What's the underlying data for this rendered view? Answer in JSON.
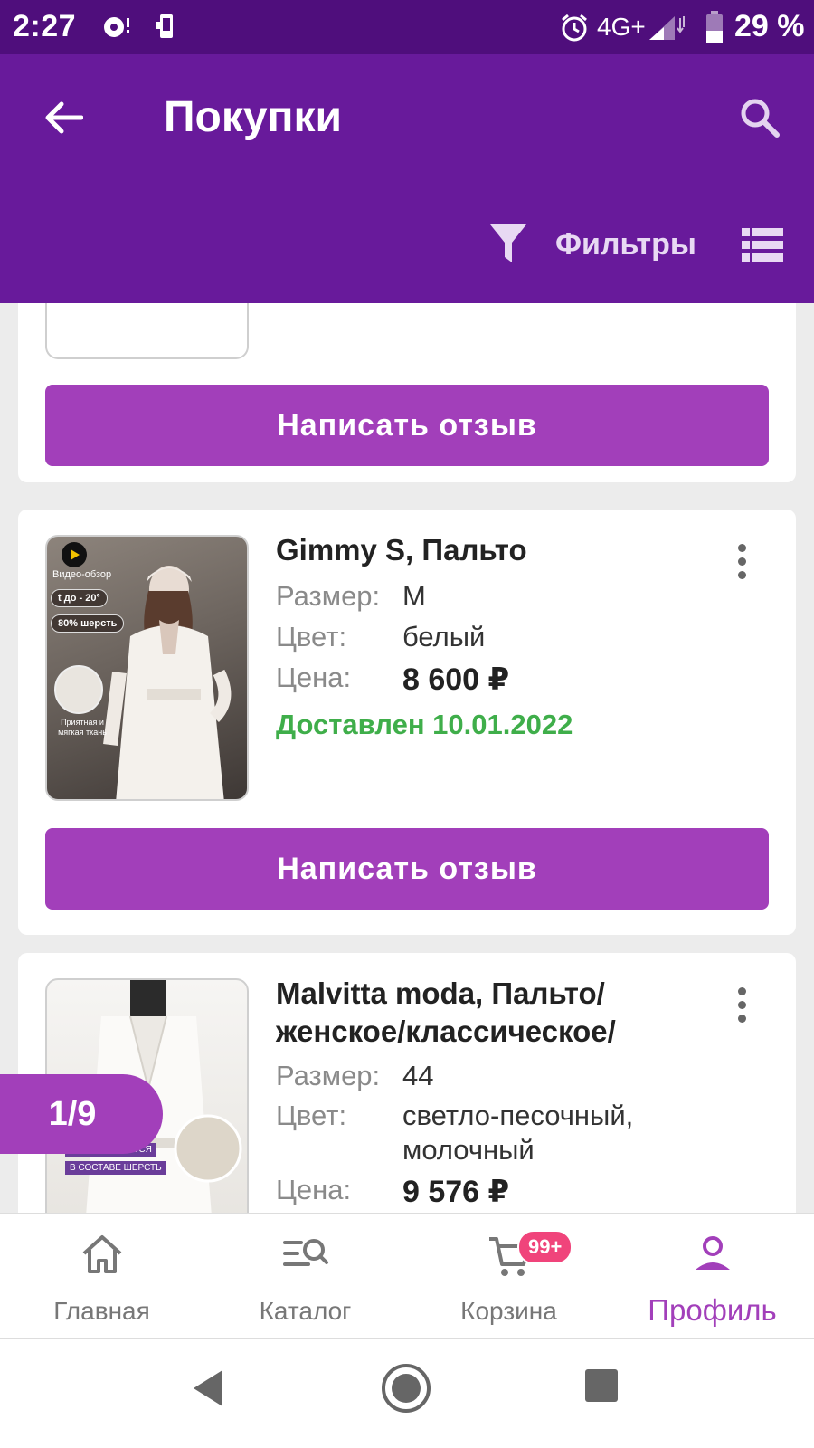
{
  "status_bar": {
    "time": "2:27",
    "network": "4G+",
    "battery": "29 %",
    "icons": [
      "settings-sync-icon",
      "phone-device-icon",
      "alarm-icon",
      "signal-icon",
      "battery-icon"
    ]
  },
  "header": {
    "title": "Покупки",
    "filters_label": "Фильтры",
    "icons": [
      "back-arrow-icon",
      "search-icon",
      "filter-icon",
      "list-view-icon"
    ]
  },
  "orders": [
    {
      "review_label": "Написать отзыв"
    },
    {
      "title": "Gimmy S, Пальто",
      "size_label": "Размер:",
      "size": "M",
      "color_label": "Цвет:",
      "color": "белый",
      "price_label": "Цена:",
      "price": "8 600 ₽",
      "status": "Доставлен 10.01.2022",
      "review_label": "Написать отзыв",
      "image_tags": {
        "video": "Видео-обзор",
        "temp": "t до - 20°",
        "wool": "80% шерсть",
        "fabric": "Приятная и мягкая ткань"
      }
    },
    {
      "title_line1": "Malvitta moda, Пальто/",
      "title_line2": "женское/классическое/",
      "size_label": "Размер:",
      "size": "44",
      "color_label": "Цвет:",
      "color_line1": "светло-песочный,",
      "color_line2": "молочный",
      "price_label": "Цена:",
      "price": "9 576 ₽",
      "image_tags": {
        "tag1": "НЕ СКАТЫВАЕТСЯ",
        "tag2": "В СОСТАВЕ ШЕРСТЬ"
      }
    }
  ],
  "page_indicator": "1/9",
  "bottom_nav": {
    "items": [
      {
        "label": "Главная",
        "icon": "home-icon"
      },
      {
        "label": "Каталог",
        "icon": "catalog-search-icon"
      },
      {
        "label": "Корзина",
        "icon": "cart-icon"
      },
      {
        "label": "Профиль",
        "icon": "profile-icon"
      }
    ],
    "cart_badge": "99+",
    "active": "Профиль",
    "accent_color": "#a23fba"
  },
  "colors": {
    "status_bar": "#4f0e7c",
    "header": "#681a9b",
    "button": "#a23fba",
    "delivered": "#3fae4a",
    "badge": "#f0447b"
  }
}
